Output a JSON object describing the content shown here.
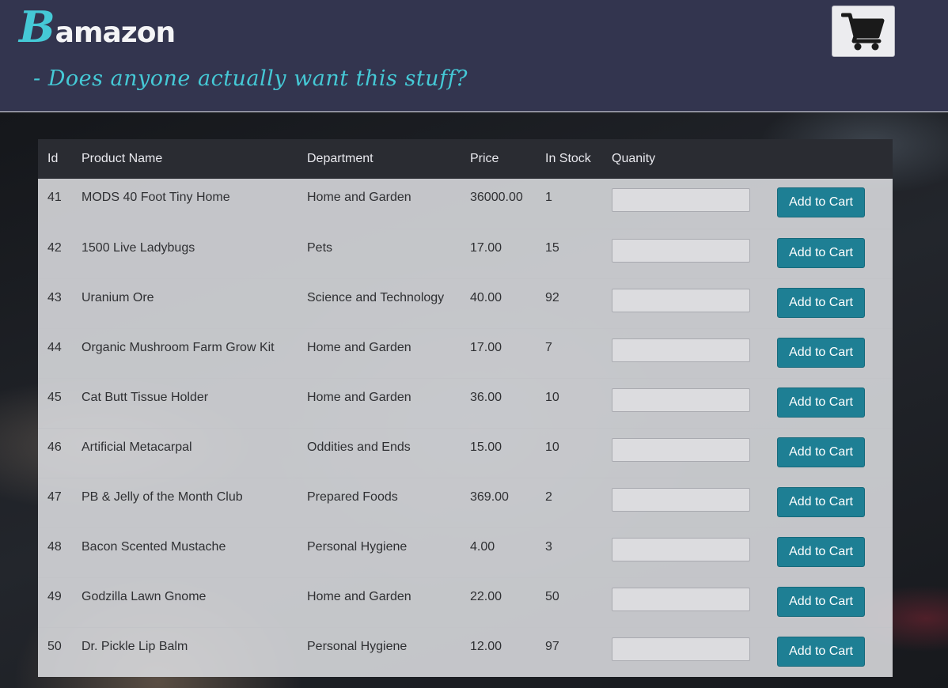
{
  "brand": {
    "logo_initial": "B",
    "logo_rest": "amazon",
    "tagline": "- Does anyone actually want this stuff?"
  },
  "header": {
    "cart_icon": "shopping-cart-icon"
  },
  "table": {
    "columns": [
      "Id",
      "Product Name",
      "Department",
      "Price",
      "In Stock",
      "Quanity",
      ""
    ],
    "add_label": "Add to Cart",
    "rows": [
      {
        "id": "41",
        "name": "MODS 40 Foot Tiny Home",
        "department": "Home and Garden",
        "price": "36000.00",
        "stock": "1",
        "qty": ""
      },
      {
        "id": "42",
        "name": "1500 Live Ladybugs",
        "department": "Pets",
        "price": "17.00",
        "stock": "15",
        "qty": ""
      },
      {
        "id": "43",
        "name": "Uranium Ore",
        "department": "Science and Technology",
        "price": "40.00",
        "stock": "92",
        "qty": ""
      },
      {
        "id": "44",
        "name": "Organic Mushroom Farm Grow Kit",
        "department": "Home and Garden",
        "price": "17.00",
        "stock": "7",
        "qty": ""
      },
      {
        "id": "45",
        "name": "Cat Butt Tissue Holder",
        "department": "Home and Garden",
        "price": "36.00",
        "stock": "10",
        "qty": ""
      },
      {
        "id": "46",
        "name": "Artificial Metacarpal",
        "department": "Oddities and Ends",
        "price": "15.00",
        "stock": "10",
        "qty": ""
      },
      {
        "id": "47",
        "name": "PB & Jelly of the Month Club",
        "department": "Prepared Foods",
        "price": "369.00",
        "stock": "2",
        "qty": ""
      },
      {
        "id": "48",
        "name": "Bacon Scented Mustache",
        "department": "Personal Hygiene",
        "price": "4.00",
        "stock": "3",
        "qty": ""
      },
      {
        "id": "49",
        "name": "Godzilla Lawn Gnome",
        "department": "Home and Garden",
        "price": "22.00",
        "stock": "50",
        "qty": ""
      },
      {
        "id": "50",
        "name": "Dr. Pickle Lip Balm",
        "department": "Personal Hygiene",
        "price": "12.00",
        "stock": "97",
        "qty": ""
      }
    ]
  },
  "colors": {
    "header_bg": "#33354f",
    "accent": "#45c9d6",
    "button": "#1e7f94"
  }
}
